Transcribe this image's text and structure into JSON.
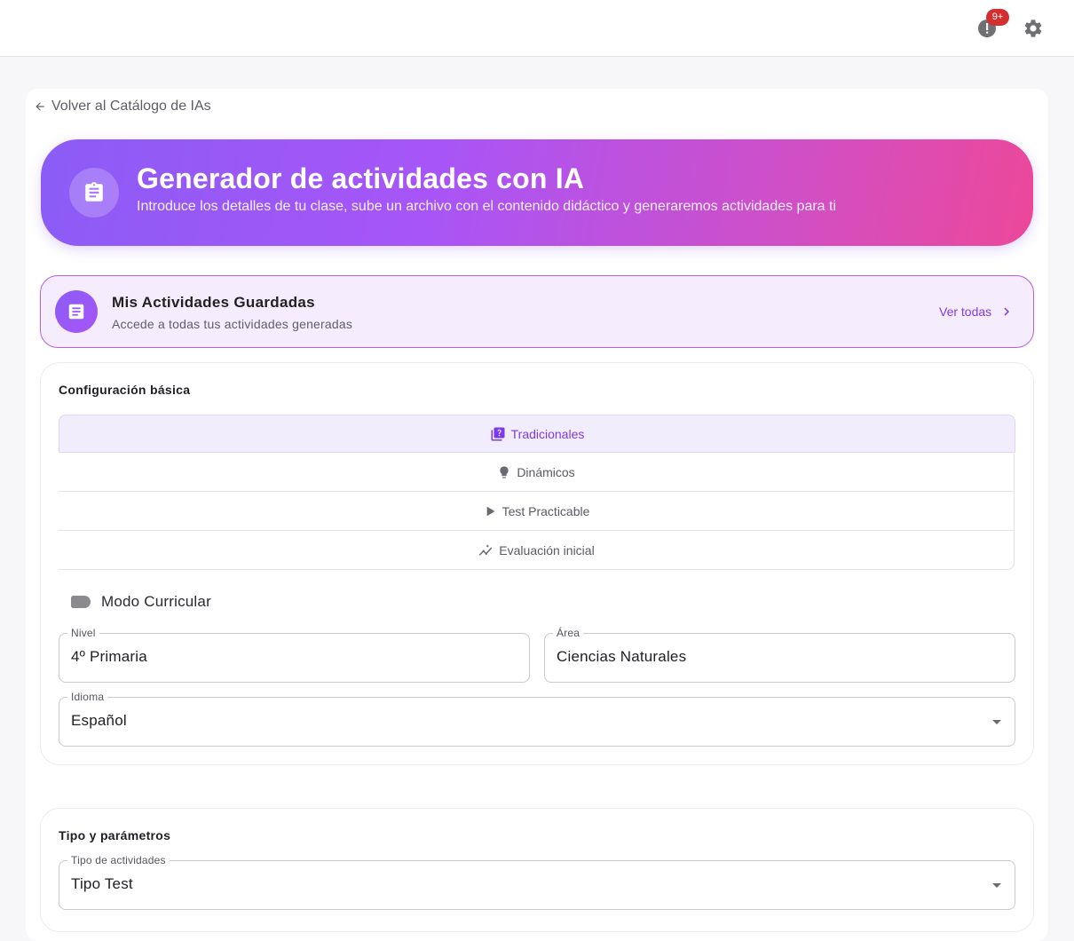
{
  "topbar": {
    "notification_badge": "9+",
    "alert_icon": "alert-circle-icon",
    "settings_icon": "gear-icon"
  },
  "back": {
    "label": "Volver al Catálogo de IAs",
    "icon": "arrow-left-icon"
  },
  "hero": {
    "title": "Generador de actividades con IA",
    "subtitle": "Introduce los detalles de tu clase, sube un archivo con el contenido didáctico y generaremos actividades para ti",
    "icon": "clipboard-icon"
  },
  "saved": {
    "title": "Mis Actividades Guardadas",
    "subtitle": "Accede a todas tus actividades generadas",
    "link_label": "Ver todas",
    "icon": "document-icon"
  },
  "basic_config": {
    "title": "Configuración básica",
    "tabs": [
      {
        "label": "Tradicionales",
        "icon": "quiz-icon",
        "active": true
      },
      {
        "label": "Dinámicos",
        "icon": "lightbulb-icon",
        "active": false
      },
      {
        "label": "Test Practicable",
        "icon": "play-icon",
        "active": false
      },
      {
        "label": "Evaluación inicial",
        "icon": "insights-icon",
        "active": false
      }
    ],
    "curricular_mode": {
      "label": "Modo Curricular",
      "enabled": false
    },
    "fields": {
      "nivel": {
        "label": "Nivel",
        "value": "4º Primaria"
      },
      "area": {
        "label": "Área",
        "value": "Ciencias Naturales"
      },
      "idioma": {
        "label": "Idioma",
        "value": "Español"
      }
    }
  },
  "type_params": {
    "title": "Tipo y parámetros",
    "tipo": {
      "label": "Tipo de actividades",
      "value": "Tipo Test"
    }
  },
  "colors": {
    "accent": "#7c3aed",
    "hero_start": "#8b5cf6",
    "hero_end": "#ec4899",
    "badge": "#d32f2f"
  }
}
